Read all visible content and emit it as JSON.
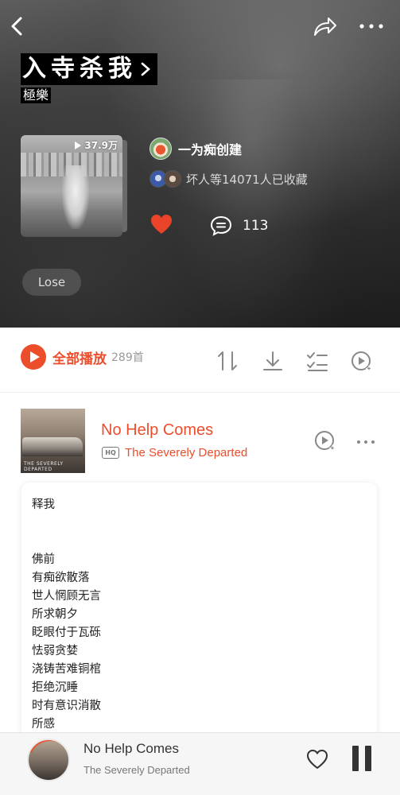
{
  "header": {
    "title": "入寺杀我",
    "subtitle": "極樂",
    "play_count": "37.9万",
    "creator_name": "一为痴创建",
    "collect_text": "坏人等14071人已收藏",
    "comment_count": "113",
    "tag": "Lose"
  },
  "toolbar": {
    "play_all_label": "全部播放",
    "track_count": "289首"
  },
  "song": {
    "title": "No Help Comes",
    "artist": "The Severely Departed",
    "quality_badge": "HQ",
    "cover_caption": "THE SEVERELY DEPARTED"
  },
  "lyrics": [
    "释我",
    "",
    "",
    "佛前",
    "有痴欲散落",
    "世人惘顾无言",
    "所求朝夕",
    "眨眼付于瓦砾",
    "怯弱贪婪",
    "浇铸苦难铜棺",
    "拒绝沉睡",
    "时有意识消散",
    "所感"
  ],
  "player": {
    "title": "No Help Comes",
    "artist": "The Severely Departed"
  },
  "colors": {
    "accent": "#ec4e2c",
    "like_red": "#e9442a"
  }
}
